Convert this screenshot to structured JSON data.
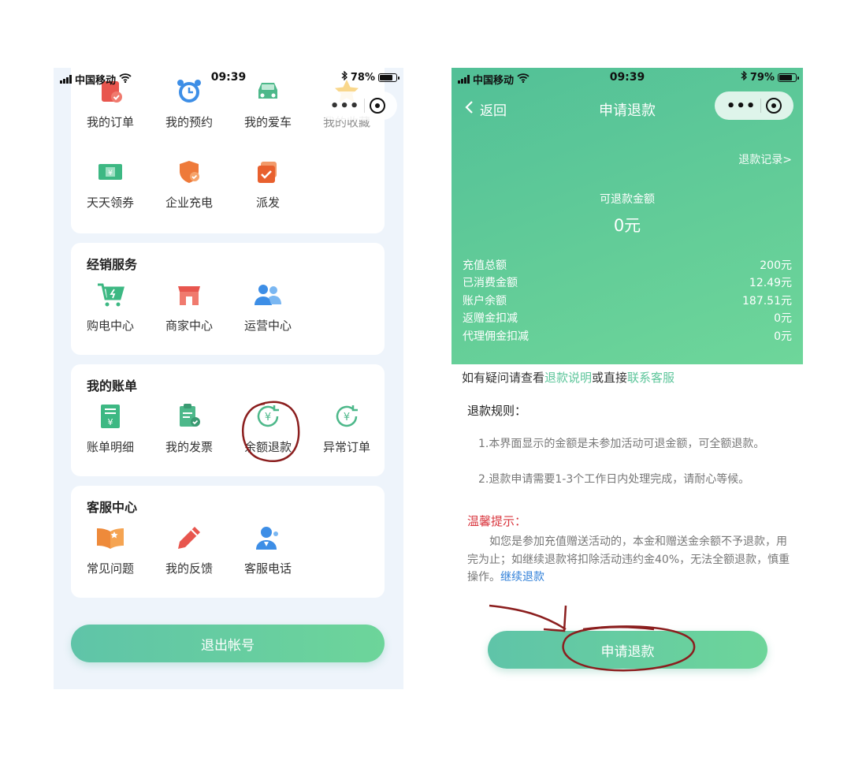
{
  "left": {
    "status": {
      "carrier": "中国移动",
      "time": "09:39",
      "battery": "78%"
    },
    "top_row": [
      "我的订单",
      "我的预约",
      "我的爱车",
      "我的收藏"
    ],
    "row2": [
      "天天领券",
      "企业充电",
      "派发"
    ],
    "dealer": {
      "title": "经销服务",
      "items": [
        "购电中心",
        "商家中心",
        "运营中心"
      ]
    },
    "bills": {
      "title": "我的账单",
      "items": [
        "账单明细",
        "我的发票",
        "余额退款",
        "异常订单"
      ]
    },
    "support": {
      "title": "客服中心",
      "items": [
        "常见问题",
        "我的反馈",
        "客服电话"
      ]
    },
    "logout_label": "退出帐号"
  },
  "right": {
    "status": {
      "carrier": "中国移动",
      "time": "09:39",
      "battery": "79%"
    },
    "nav": {
      "back": "返回",
      "title": "申请退款"
    },
    "records_link": "退款记录>",
    "available_label": "可退款金额",
    "available_value": "0元",
    "stats": [
      {
        "label": "充值总额",
        "value": "200元"
      },
      {
        "label": "已消费金额",
        "value": "12.49元"
      },
      {
        "label": "账户余额",
        "value": "187.51元"
      },
      {
        "label": "返赠金扣减",
        "value": "0元"
      },
      {
        "label": "代理佣金扣减",
        "value": "0元"
      }
    ],
    "help": {
      "prefix": "如有疑问请查看",
      "link1": "退款说明",
      "middle": "或直接",
      "link2": "联系客服"
    },
    "rules_title": "退款规则：",
    "rule1": "1.本界面显示的金额是未参加活动可退金额，可全额退款。",
    "rule2": "2.退款申请需要1-3个工作日内处理完成，请耐心等候。",
    "tip_title": "温馨提示：",
    "tip_text": "如您是参加充值赠送活动的，本金和赠送金余额不予退款，用完为止；如继续退款将扣除活动违约金40%，无法全额退款，慎重操作。",
    "tip_link": "继续退款",
    "apply_label": "申请退款"
  },
  "colors": {
    "primary_green": "#5cc59a",
    "warning_red": "#d9363e",
    "link_blue": "#2f7fd8",
    "annotation": "#8b1e1e"
  }
}
